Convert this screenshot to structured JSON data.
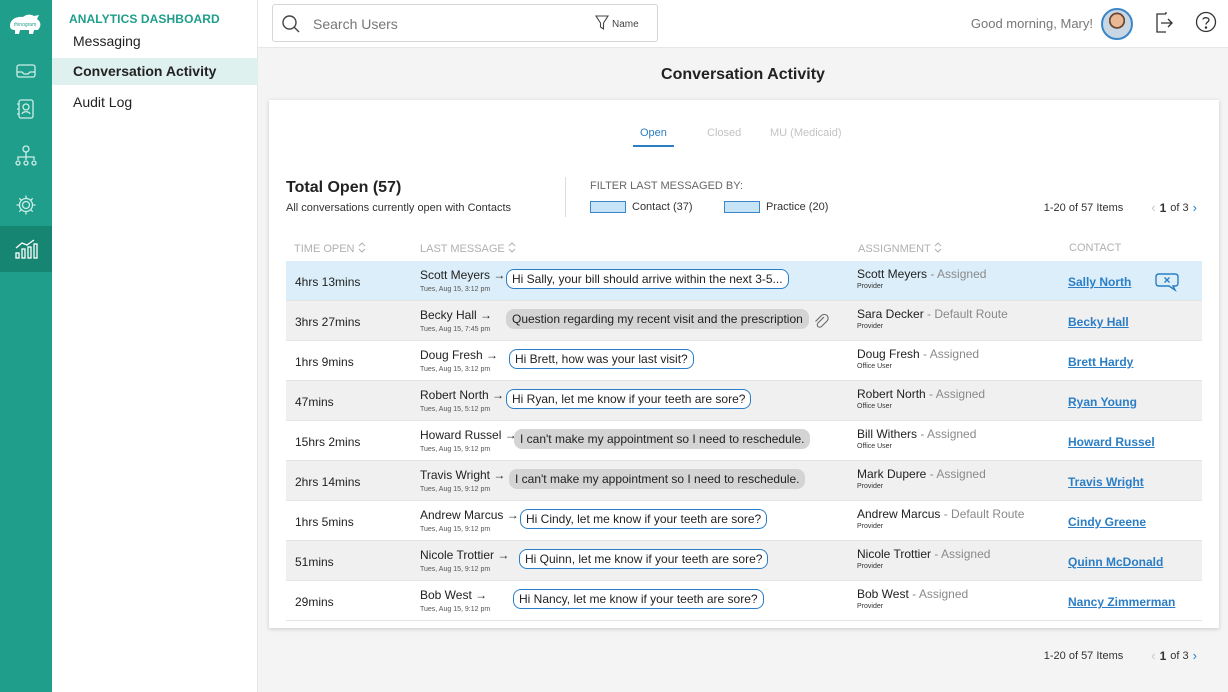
{
  "rail": {
    "logo_text": "rhinogram",
    "icons": [
      "inbox-icon",
      "contacts-icon",
      "org-chart-icon",
      "settings-icon",
      "analytics-icon"
    ]
  },
  "subnav": {
    "header": "ANALYTICS DASHBOARD",
    "items": [
      {
        "label": "Messaging",
        "active": false
      },
      {
        "label": "Conversation Activity",
        "active": true
      },
      {
        "label": "Audit Log",
        "active": false
      }
    ]
  },
  "topbar": {
    "search_placeholder": "Search Users",
    "filter_label": "Name",
    "greeting": "Good morning, Mary!"
  },
  "page": {
    "title": "Conversation Activity"
  },
  "tabs": [
    {
      "label": "Open",
      "active": true
    },
    {
      "label": "Closed",
      "active": false
    },
    {
      "label": "MU (Medicaid)",
      "active": false
    }
  ],
  "summary": {
    "title": "Total Open (57)",
    "subtitle": "All conversations currently open with Contacts",
    "filter_title": "FILTER LAST MESSAGED BY:",
    "contact_label": "Contact (37)",
    "practice_label": "Practice (20)"
  },
  "pagination": {
    "range": "1-20 of 57 Items",
    "current": "1",
    "of_text": "of 3"
  },
  "columns": {
    "time": "TIME OPEN",
    "message": "LAST MESSAGE",
    "assignment": "ASSIGNMENT",
    "contact": "CONTACT"
  },
  "colors": {
    "accent": "#1f9e8b",
    "link": "#2b7ec6",
    "selected_row": "#dbeef9"
  },
  "rows": [
    {
      "time": "4hrs 13mins",
      "sender": "Scott Meyers",
      "date": "Tues, Aug 15, 3:12 pm",
      "message": "Hi Sally, your bill should arrive within the next 3-5...",
      "from": "contact",
      "attachment": false,
      "assignee": "Scott Meyers",
      "status": "Assigned",
      "role": "Provider",
      "contact": "Sally North",
      "selected": true
    },
    {
      "time": "3hrs 27mins",
      "sender": "Becky Hall",
      "date": "Tues, Aug 15, 7:45 pm",
      "message": "Question regarding my recent visit and the prescription",
      "from": "practice",
      "attachment": true,
      "assignee": "Sara Decker",
      "status": "Default Route",
      "role": "Provider",
      "contact": "Becky Hall",
      "selected": false
    },
    {
      "time": "1hrs 9mins",
      "sender": "Doug Fresh",
      "date": "Tues, Aug 15, 3:12 pm",
      "message": "Hi Brett, how was your last visit?",
      "from": "contact",
      "attachment": false,
      "assignee": "Doug Fresh",
      "status": "Assigned",
      "role": "Office User",
      "contact": "Brett Hardy",
      "selected": false
    },
    {
      "time": "47mins",
      "sender": "Robert North",
      "date": "Tues, Aug 15, 5:12 pm",
      "message": "Hi Ryan, let me know if your teeth are sore?",
      "from": "contact",
      "attachment": false,
      "assignee": "Robert North",
      "status": "Assigned",
      "role": "Office User",
      "contact": "Ryan Young",
      "selected": false
    },
    {
      "time": "15hrs 2mins",
      "sender": "Howard Russel",
      "date": "Tues, Aug 15, 9:12 pm",
      "message": "I can't make my appointment so I need to reschedule.",
      "from": "practice",
      "attachment": false,
      "assignee": "Bill Withers",
      "status": "Assigned",
      "role": "Office User",
      "contact": "Howard Russel",
      "selected": false
    },
    {
      "time": "2hrs 14mins",
      "sender": "Travis Wright",
      "date": "Tues, Aug 15, 9:12 pm",
      "message": "I can't make my appointment so I need to reschedule.",
      "from": "practice",
      "attachment": false,
      "assignee": "Mark Dupere",
      "status": "Assigned",
      "role": "Provider",
      "contact": "Travis Wright",
      "selected": false
    },
    {
      "time": "1hrs 5mins",
      "sender": "Andrew Marcus",
      "date": "Tues, Aug 15, 9:12 pm",
      "message": "Hi Cindy, let me know if your teeth are sore?",
      "from": "contact",
      "attachment": false,
      "assignee": "Andrew Marcus",
      "status": "Default Route",
      "role": "Provider",
      "contact": "Cindy Greene",
      "selected": false
    },
    {
      "time": "51mins",
      "sender": "Nicole Trottier",
      "date": "Tues, Aug 15, 9:12 pm",
      "message": "Hi Quinn, let me know if your teeth are sore?",
      "from": "contact",
      "attachment": false,
      "assignee": "Nicole Trottier",
      "status": "Assigned",
      "role": "Provider",
      "contact": "Quinn McDonald",
      "selected": false
    },
    {
      "time": "29mins",
      "sender": "Bob West",
      "date": "Tues, Aug 15, 9:12 pm",
      "message": "Hi Nancy, let me know if your teeth are sore?",
      "from": "contact",
      "attachment": false,
      "assignee": "Bob West",
      "status": "Assigned",
      "role": "Provider",
      "contact": "Nancy Zimmerman",
      "selected": false
    }
  ]
}
